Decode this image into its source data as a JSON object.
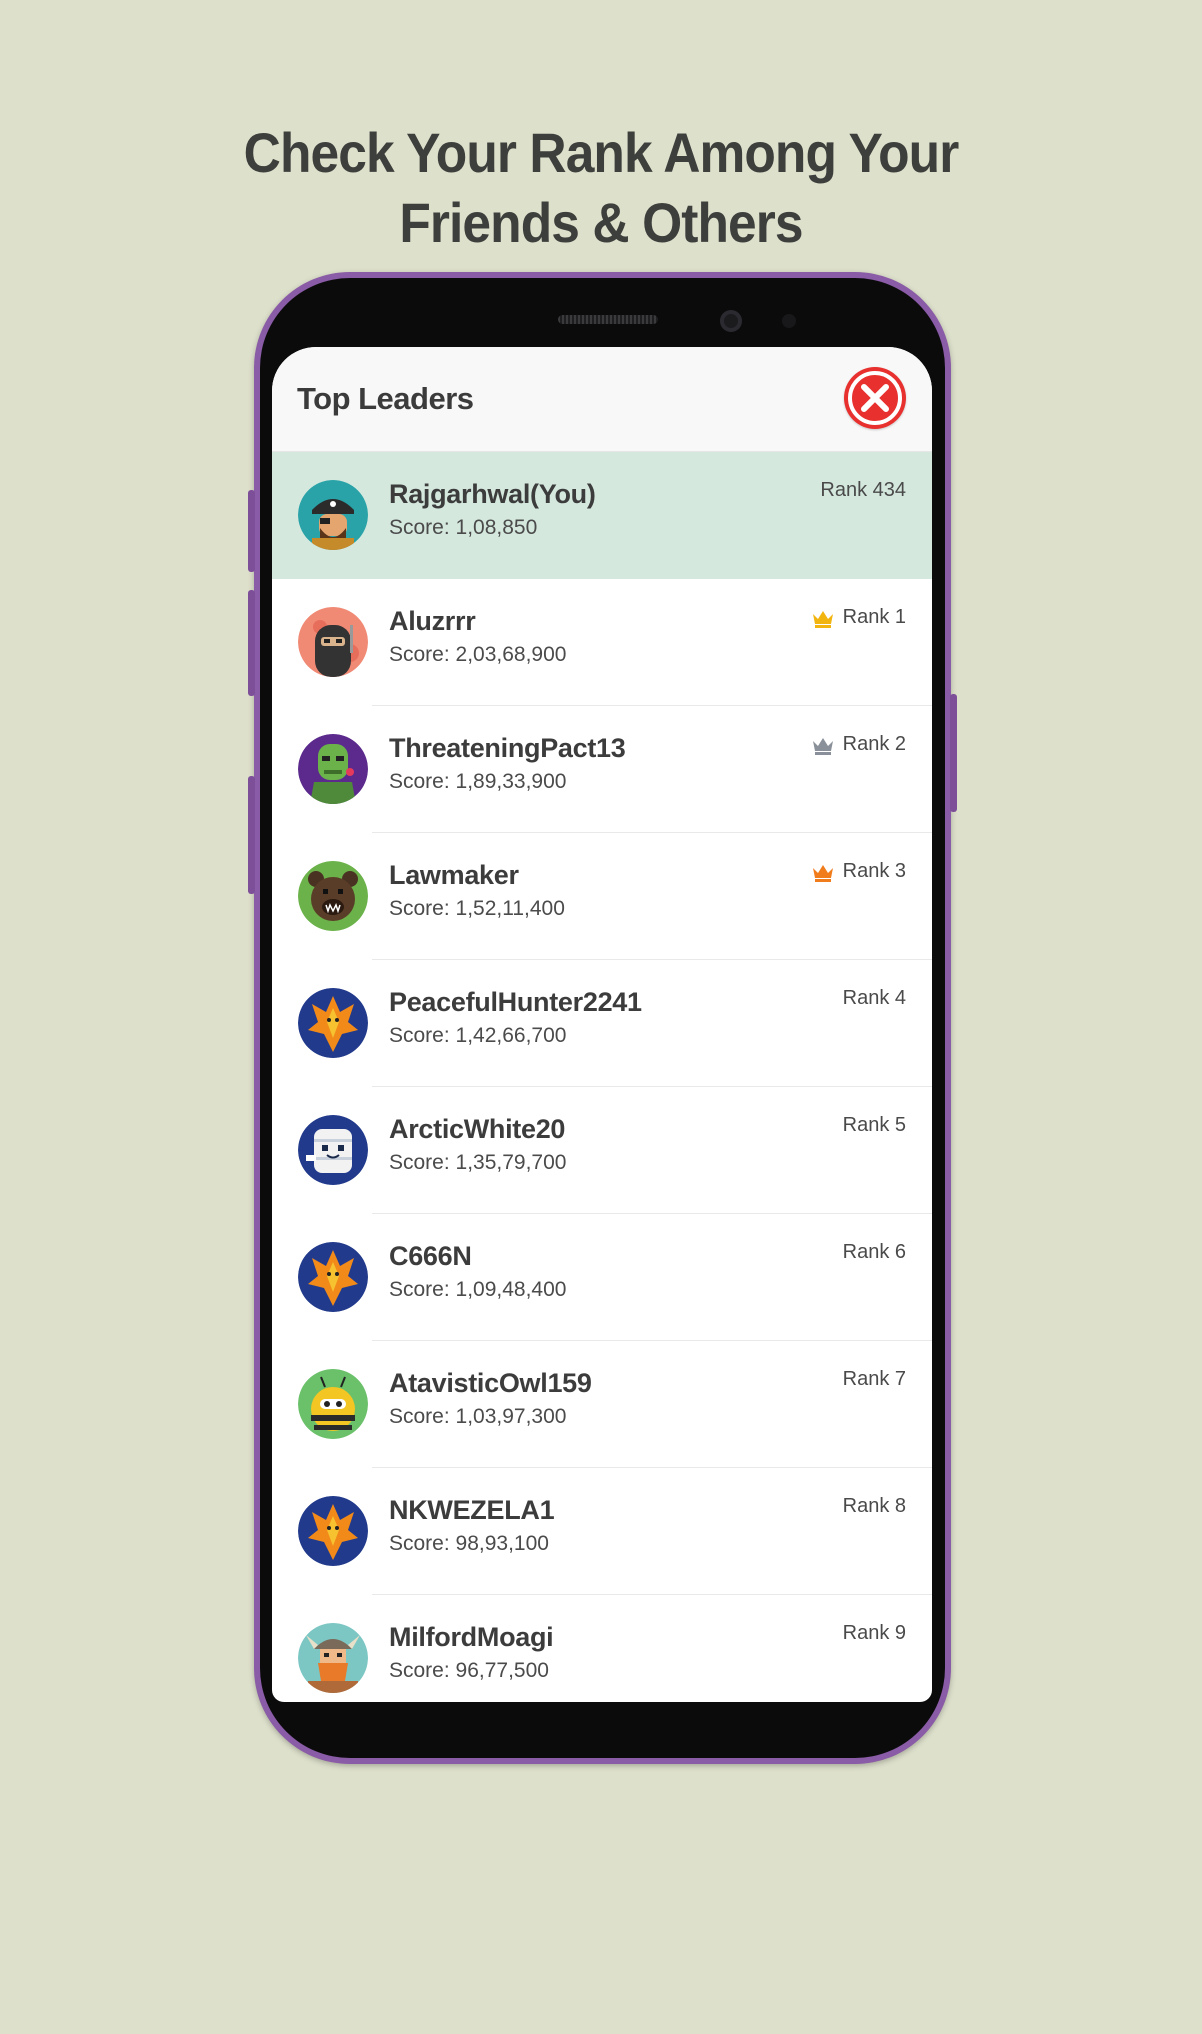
{
  "headline": {
    "line1": "Check Your Rank Among Your",
    "line2": "Friends & Others"
  },
  "screen": {
    "title": "Top Leaders",
    "close_icon": "close-icon"
  },
  "colors": {
    "background": "#dde0cb",
    "phone_frame": "#8a5ba6",
    "highlight_row": "#d4e8de",
    "close_button": "#e8312e",
    "gold_crown": "#f2b50f",
    "silver_crown": "#8a9099",
    "bronze_crown": "#f07c1c"
  },
  "leaders": [
    {
      "name": "Rajgarhwal(You)",
      "score": "Score: 1,08,850",
      "rank": "Rank 434",
      "avatar": "pirate-avatar-icon",
      "crown": null
    },
    {
      "name": "Aluzrrr",
      "score": "Score: 2,03,68,900",
      "rank": "Rank 1",
      "avatar": "ninja-avatar-icon",
      "crown": "gold"
    },
    {
      "name": "ThreateningPact13",
      "score": "Score: 1,89,33,900",
      "rank": "Rank 2",
      "avatar": "zombie-avatar-icon",
      "crown": "silver"
    },
    {
      "name": "Lawmaker",
      "score": "Score: 1,52,11,400",
      "rank": "Rank 3",
      "avatar": "bear-avatar-icon",
      "crown": "bronze"
    },
    {
      "name": "PeacefulHunter2241",
      "score": "Score: 1,42,66,700",
      "rank": "Rank 4",
      "avatar": "phoenix-avatar-icon",
      "crown": null
    },
    {
      "name": "ArcticWhite20",
      "score": "Score: 1,35,79,700",
      "rank": "Rank 5",
      "avatar": "mummy-avatar-icon",
      "crown": null
    },
    {
      "name": "C666N",
      "score": "Score: 1,09,48,400",
      "rank": "Rank 6",
      "avatar": "phoenix-avatar-icon",
      "crown": null
    },
    {
      "name": "AtavisticOwl159",
      "score": "Score: 1,03,97,300",
      "rank": "Rank 7",
      "avatar": "bee-avatar-icon",
      "crown": null
    },
    {
      "name": "NKWEZELA1",
      "score": "Score: 98,93,100",
      "rank": "Rank 8",
      "avatar": "phoenix-avatar-icon",
      "crown": null
    },
    {
      "name": "MilfordMoagi",
      "score": "Score: 96,77,500",
      "rank": "Rank 9",
      "avatar": "viking-avatar-icon",
      "crown": null
    }
  ]
}
